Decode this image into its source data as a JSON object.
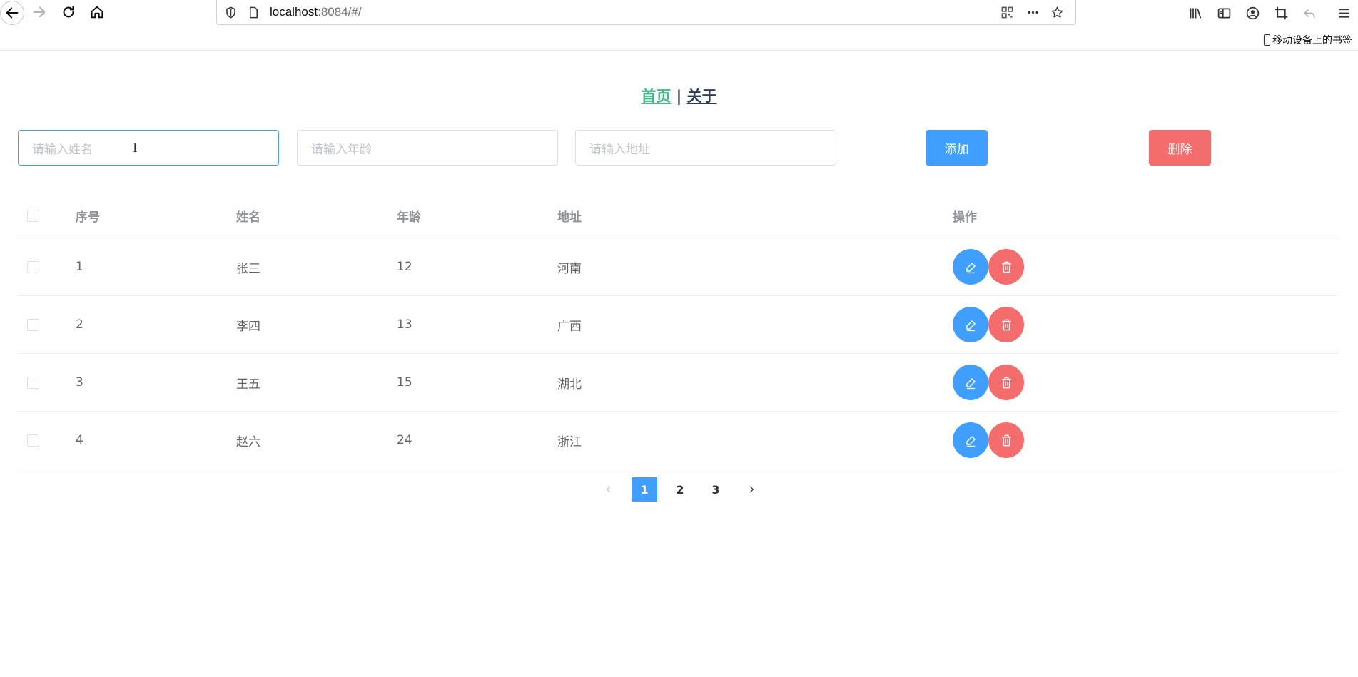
{
  "browser": {
    "url_host": "localhost",
    "url_rest": ":8084/#/",
    "bookmarks_label": "移动设备上的书签"
  },
  "nav": {
    "home_label": "首页",
    "separator": "|",
    "about_label": "关于"
  },
  "form": {
    "name_placeholder": "请输入姓名",
    "age_placeholder": "请输入年龄",
    "address_placeholder": "请输入地址",
    "add_label": "添加",
    "delete_label": "删除"
  },
  "table": {
    "headers": {
      "index": "序号",
      "name": "姓名",
      "age": "年龄",
      "address": "地址",
      "actions": "操作"
    },
    "rows": [
      {
        "index": "1",
        "name": "张三",
        "age": "12",
        "address": "河南"
      },
      {
        "index": "2",
        "name": "李四",
        "age": "13",
        "address": "广西"
      },
      {
        "index": "3",
        "name": "王五",
        "age": "15",
        "address": "湖北"
      },
      {
        "index": "4",
        "name": "赵六",
        "age": "24",
        "address": "浙江"
      }
    ]
  },
  "pagination": {
    "pages": [
      "1",
      "2",
      "3"
    ],
    "current": "1"
  },
  "colors": {
    "primary": "#409eff",
    "danger": "#f56c6c",
    "nav_active": "#42b983",
    "nav_text": "#2c3e50"
  }
}
